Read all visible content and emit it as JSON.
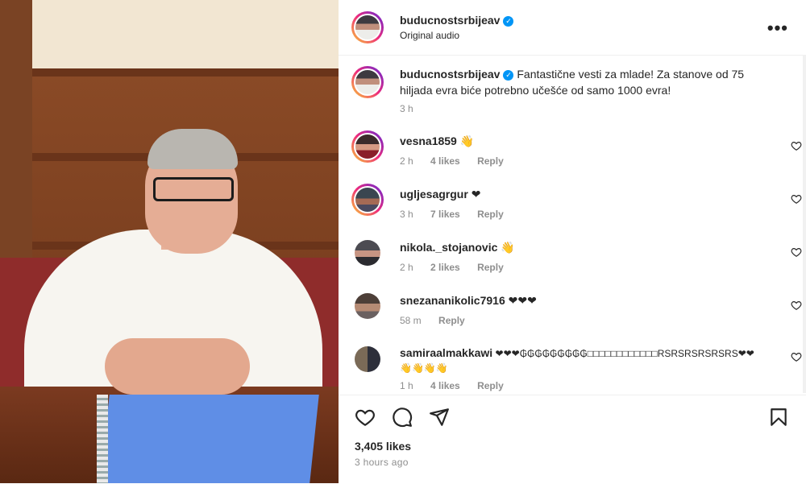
{
  "post": {
    "username": "buducnostsrbijeav",
    "audio_label": "Original audio",
    "caption": "Fantastične vesti za mlade! Za stanove od 75 hiljada evra biće potrebno učešće od samo 1000 evra!",
    "caption_time": "3 h",
    "likes": "3,405 likes",
    "posted_ago": "3 hours ago"
  },
  "comments": [
    {
      "username": "vesna1859",
      "text": "👋",
      "time": "2 h",
      "likes": "4 likes",
      "reply": "Reply"
    },
    {
      "username": "ugljesagrgur",
      "text": "❤",
      "time": "3 h",
      "likes": "7 likes",
      "reply": "Reply"
    },
    {
      "username": "nikola._stojanovic",
      "text": "👋",
      "time": "2 h",
      "likes": "2 likes",
      "reply": "Reply"
    },
    {
      "username": "snezananikolic7916",
      "text": "❤❤❤",
      "time": "58 m",
      "likes": "",
      "reply": "Reply"
    },
    {
      "username": "samiraalmakkawi",
      "text": "❤❤❤₲₲₲₲₲₲₲₲₲□□□□□□□□□□□□RSRSRSRSRSRS❤❤👋👋👋👋",
      "time": "1 h",
      "likes": "4 likes",
      "reply": "Reply"
    }
  ],
  "icons": {
    "like": "heart-icon",
    "comment": "comment-bubble-icon",
    "share": "paper-plane-icon",
    "save": "bookmark-icon",
    "more": "more-options-icon",
    "verified": "verified-badge-icon"
  },
  "colors": {
    "verified": "#0095f6",
    "text": "#262626",
    "muted": "#8e8e8e"
  }
}
